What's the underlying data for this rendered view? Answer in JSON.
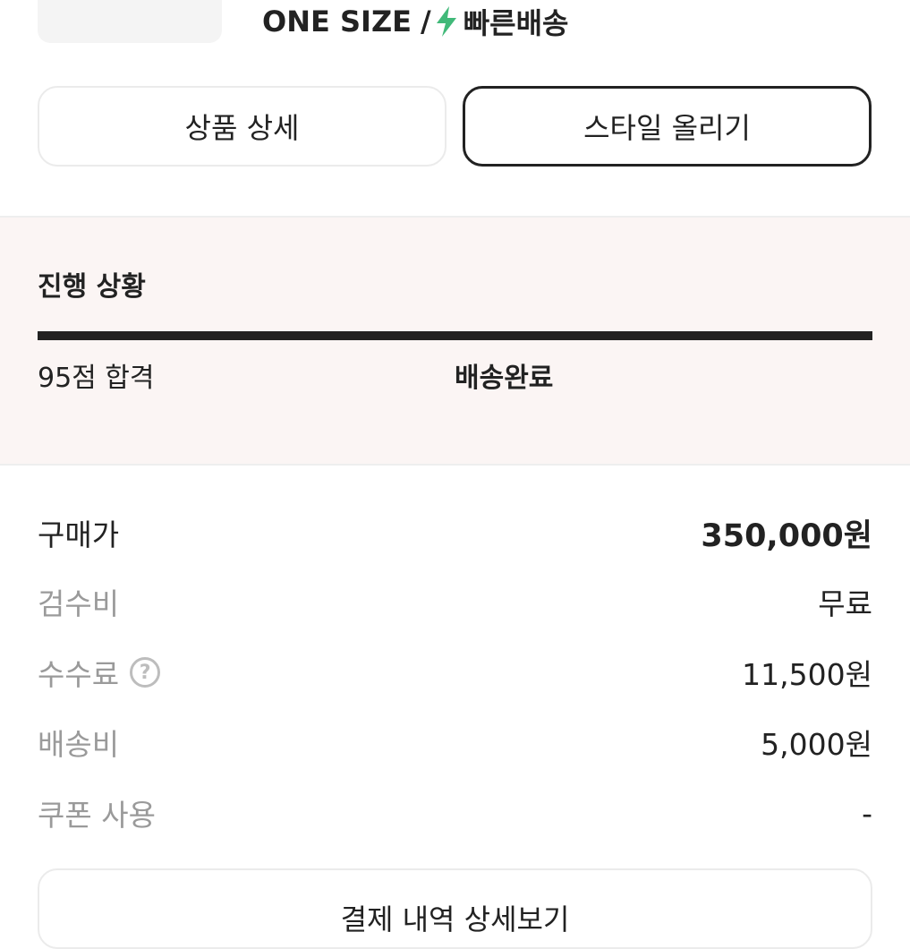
{
  "product": {
    "size": "ONE SIZE",
    "separator": "/",
    "delivery_badge": "빠른배송",
    "delivery_icon": "lightning-bolt-icon",
    "delivery_icon_color": "#41b979"
  },
  "actions": {
    "detail_label": "상품 상세",
    "style_label": "스타일 올리기"
  },
  "progress": {
    "title": "진행 상황",
    "completion": 1.0,
    "step_left": "95점 합격",
    "step_current": "배송완료",
    "background_color": "#fbf5f4"
  },
  "payment": {
    "rows": [
      {
        "label": "구매가",
        "value": "350,000원"
      },
      {
        "label": "검수비",
        "value": "무료"
      },
      {
        "label": "수수료",
        "value": "11,500원",
        "help_icon": "question-circle-icon"
      },
      {
        "label": "배송비",
        "value": "5,000원"
      },
      {
        "label": "쿠폰 사용",
        "value": "-"
      }
    ],
    "details_button": "결제 내역 상세보기"
  }
}
